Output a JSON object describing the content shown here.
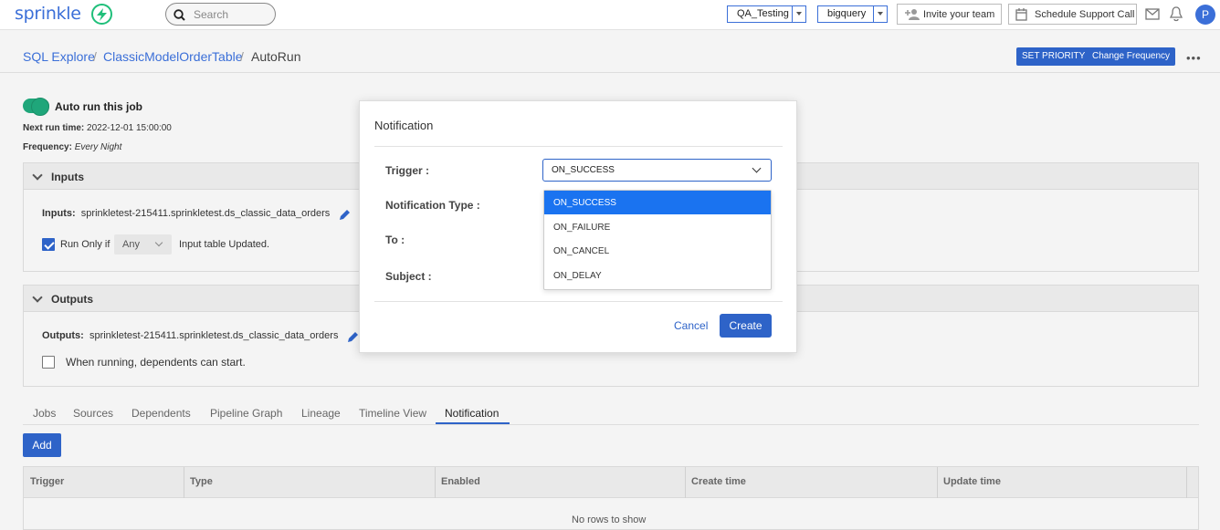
{
  "app": {
    "logo": "sprinkle"
  },
  "search": {
    "placeholder": "Search"
  },
  "topbar": {
    "workspace": "QA_Testing",
    "warehouse": "bigquery",
    "invite_label": "Invite your team",
    "support_label": "Schedule Support Call",
    "avatar_initial": "P"
  },
  "breadcrumb": {
    "items": [
      "SQL Explore",
      "ClassicModelOrderTable",
      "AutoRun"
    ],
    "separator": "/"
  },
  "header_actions": {
    "set_priority": "SET PRIORITY",
    "change_frequency": "Change Frequency"
  },
  "autorun": {
    "label": "Auto run this job",
    "next_run_label": "Next run time:",
    "next_run_value": "2022-12-01 15:00:00",
    "frequency_label": "Frequency:",
    "frequency_value": "Every Night"
  },
  "inputs": {
    "title": "Inputs",
    "label": "Inputs:",
    "value": "sprinkletest-215411.sprinkletest.ds_classic_data_orders",
    "run_only_if": "Run Only if",
    "condition": "Any",
    "condition_suffix": "Input table Updated."
  },
  "outputs": {
    "title": "Outputs",
    "label": "Outputs:",
    "value": "sprinkletest-215411.sprinkletest.ds_classic_data_orders",
    "dependents_label": "When running, dependents can start."
  },
  "tabs": [
    "Jobs",
    "Sources",
    "Dependents",
    "Pipeline Graph",
    "Lineage",
    "Timeline View",
    "Notification"
  ],
  "active_tab": "Notification",
  "add_button": "Add",
  "table": {
    "columns": [
      "Trigger",
      "Type",
      "Enabled",
      "Create time",
      "Update time"
    ],
    "empty_text": "No rows to show"
  },
  "modal": {
    "title": "Notification",
    "trigger_label": "Trigger :",
    "type_label": "Notification Type :",
    "to_label": "To :",
    "subject_label": "Subject :",
    "trigger_value": "ON_SUCCESS",
    "trigger_options": [
      "ON_SUCCESS",
      "ON_FAILURE",
      "ON_CANCEL",
      "ON_DELAY"
    ],
    "cancel": "Cancel",
    "create": "Create"
  },
  "colors": {
    "primary": "#2e63c8",
    "accent_green": "#1fa67a",
    "dropdown_highlight": "#1a73f0"
  }
}
